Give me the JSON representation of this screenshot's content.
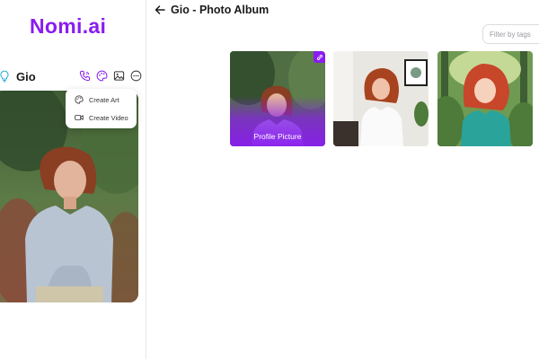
{
  "app": {
    "logo": "Nomi.ai",
    "brand_color": "#8a1cf0"
  },
  "sidebar": {
    "character": {
      "name": "Gio",
      "icons": [
        "lightbulb-icon",
        "phone-icon",
        "palette-icon",
        "image-icon",
        "more-icon"
      ]
    },
    "menu": [
      {
        "label": "Create Art",
        "icon": "palette-icon"
      },
      {
        "label": "Create Video",
        "icon": "video-icon"
      }
    ]
  },
  "main": {
    "title": "Gio - Photo Album",
    "filter_placeholder": "Filter by tags",
    "photos": [
      {
        "label": "Profile Picture",
        "badge": "link-icon"
      },
      {
        "label": ""
      },
      {
        "label": ""
      }
    ]
  }
}
